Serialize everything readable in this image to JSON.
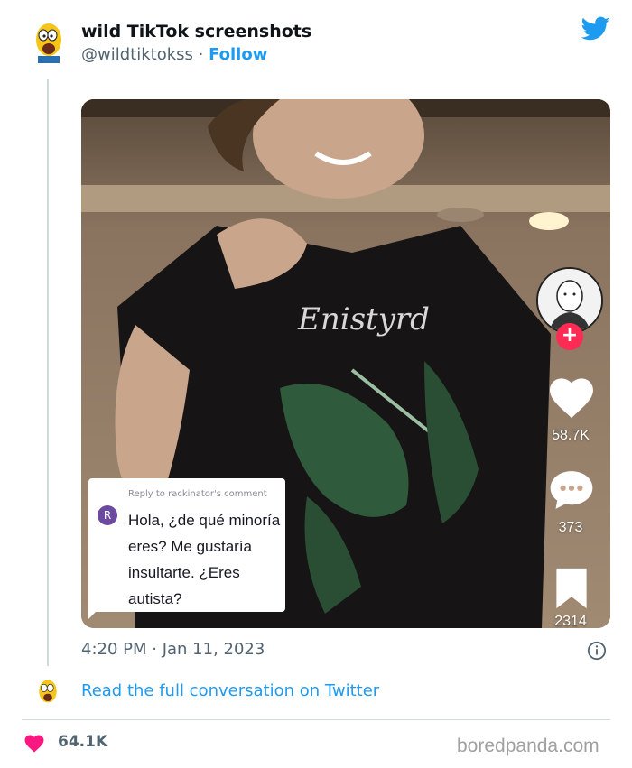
{
  "tweet": {
    "author_name": "wild TikTok screenshots",
    "author_handle": "@wildtiktokss",
    "separator": " · ",
    "follow_label": "Follow",
    "timestamp": "4:20 PM · Jan 11, 2023",
    "read_more": "Read the full conversation on Twitter",
    "likes": "64.1K"
  },
  "tiktok": {
    "reply_header": "Reply to rackinator's comment",
    "reply_initial": "R",
    "comment_text": "Hola, ¿de qué minoría eres? Me gustaría insultarte. ¿Eres autista?",
    "like_count": "58.7K",
    "comment_count": "373",
    "share_count": "2314",
    "follow_plus": "+"
  },
  "brand": "boredpanda.com",
  "colors": {
    "accent": "#1d9bf0",
    "like": "#f91880",
    "tiktok_red": "#fe2c55"
  },
  "icons": [
    "twitter-bird-icon",
    "info-icon",
    "heart-icon",
    "tiktok-heart-icon",
    "tiktok-comment-icon",
    "tiktok-share-icon"
  ]
}
